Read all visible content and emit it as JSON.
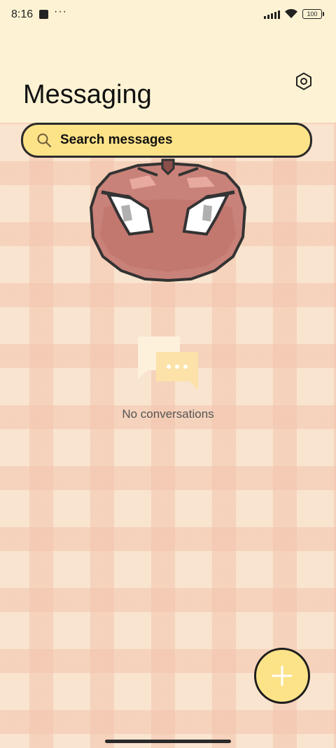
{
  "status_bar": {
    "time": "8:16",
    "notification_dots": "···",
    "battery_level": "100"
  },
  "header": {
    "title": "Messaging",
    "settings_icon": "settings-hexagon-icon"
  },
  "search": {
    "placeholder": "Search messages",
    "icon": "search-icon"
  },
  "empty_state": {
    "icon": "chat-bubbles-icon",
    "message": "No conversations"
  },
  "fab": {
    "icon": "plus-icon"
  },
  "colors": {
    "accent": "#fde388",
    "header_bg": "#fdf3d4",
    "pattern_base": "#f9e4cf",
    "pattern_stripe": "#f3c4ad",
    "mascot": "#c47a72"
  }
}
